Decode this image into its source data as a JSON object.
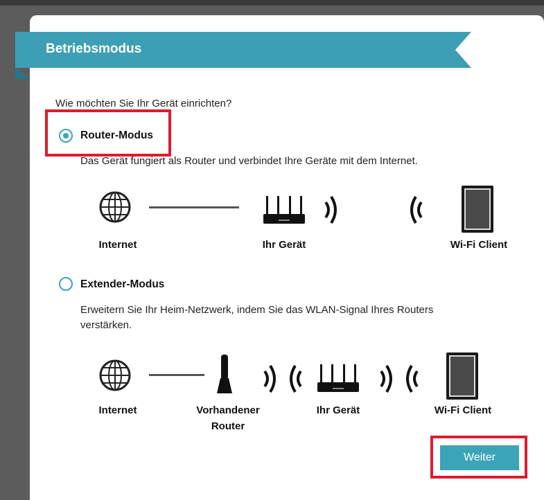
{
  "window": {
    "title": "Betriebsmodus"
  },
  "question": "Wie möchten Sie Ihr Gerät einrichten?",
  "modes": [
    {
      "label": "Router-Modus",
      "selected": true,
      "description": "Das Gerät fungiert als Router und verbindet Ihre Geräte mit dem Internet.",
      "diagram": {
        "captions": [
          "Internet",
          "Ihr Gerät",
          "Wi-Fi Client"
        ],
        "icons": [
          "globe-icon",
          "router-icon",
          "wifi-signal-icon",
          "tablet-icon"
        ]
      }
    },
    {
      "label": "Extender-Modus",
      "selected": false,
      "description_line1": "Erweitern Sie Ihr Heim-Netzwerk, indem Sie das WLAN-Signal Ihres Routers",
      "description_line2": "verstärken.",
      "diagram": {
        "captions": [
          "Internet",
          "Vorhandener",
          "Router",
          "Ihr Gerät",
          "Wi-Fi Client"
        ],
        "icons": [
          "globe-icon",
          "existing-router-icon",
          "router-icon",
          "wifi-signal-icon",
          "tablet-icon"
        ]
      }
    }
  ],
  "next_button": "Weiter",
  "colors": {
    "accent": "#3ca4b8",
    "banner": "#3c9fb3",
    "banner_shadow": "#2a7585",
    "highlight": "#dd1c2c"
  }
}
